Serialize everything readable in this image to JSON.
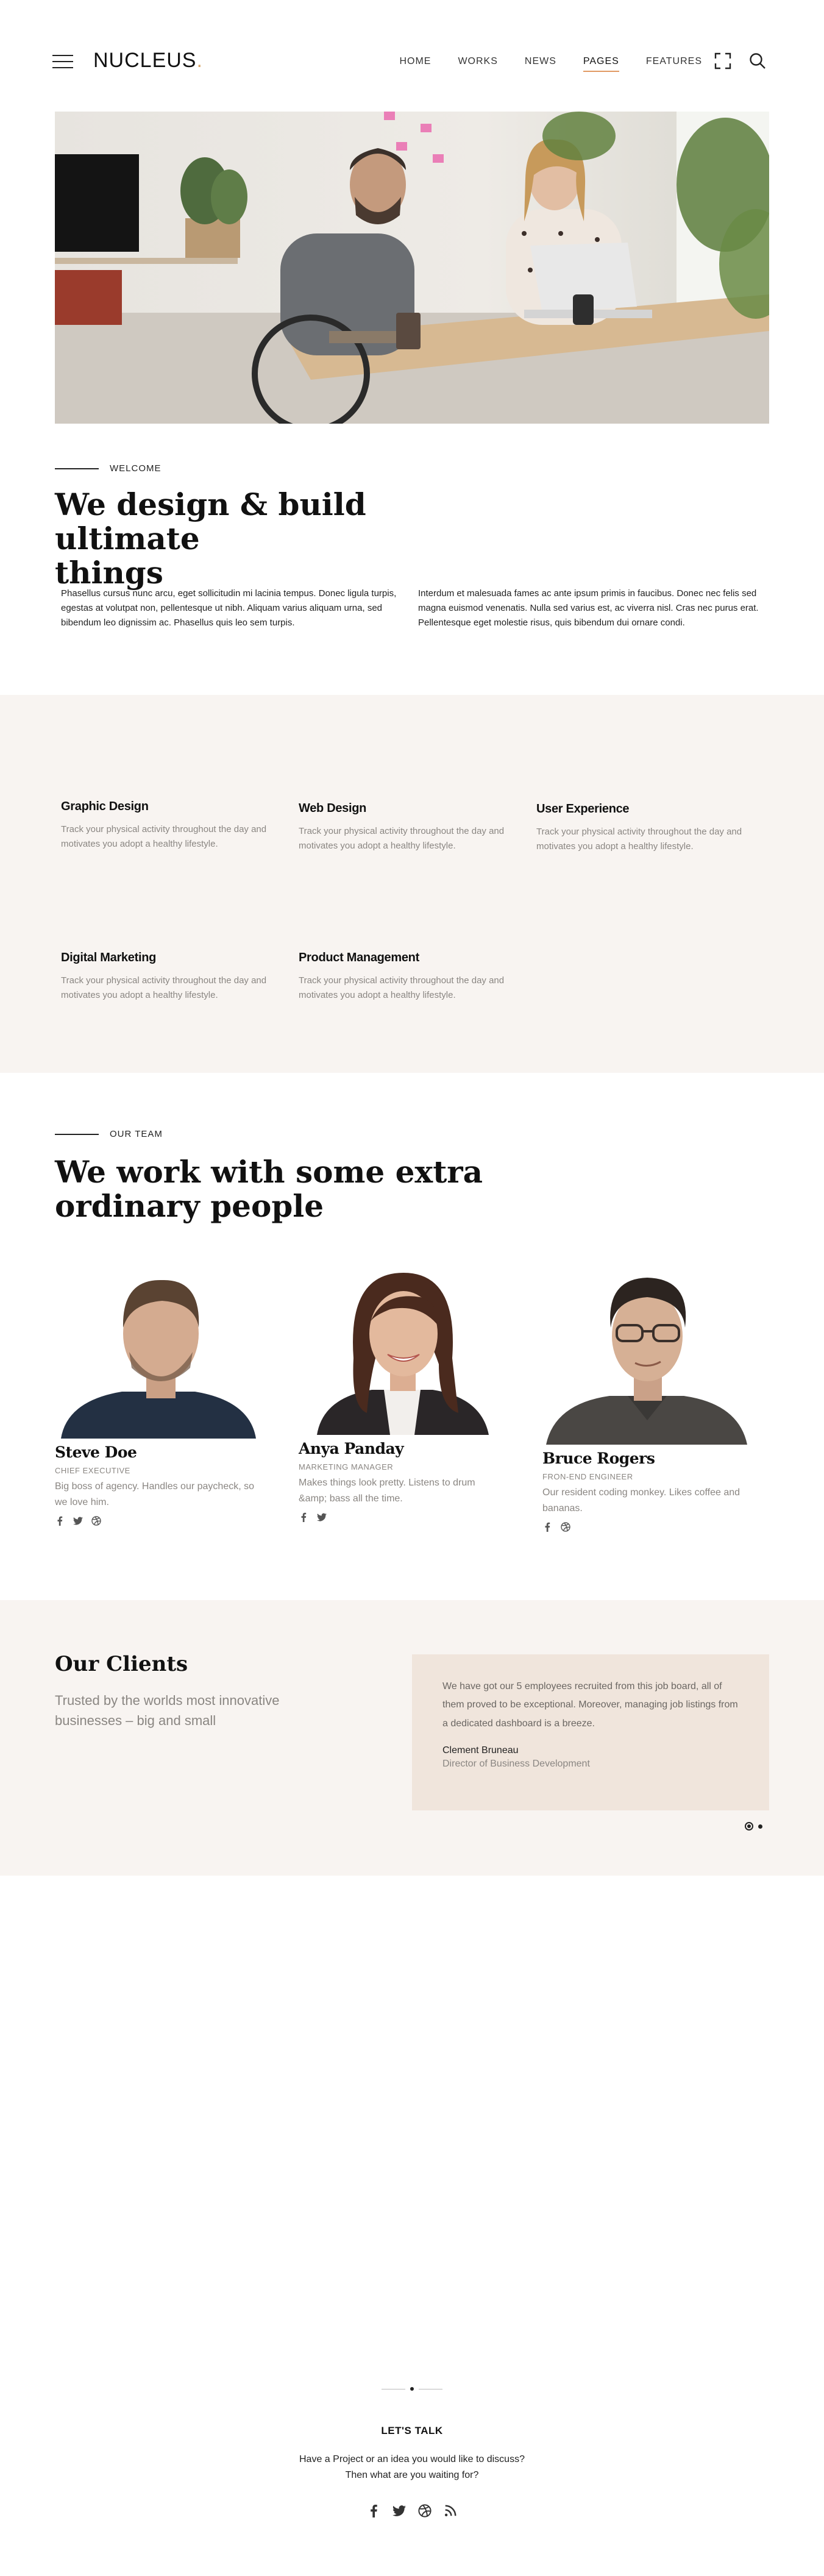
{
  "header": {
    "logo_text": "NUCLEUS",
    "logo_dot": ".",
    "nav": [
      {
        "label": "HOME"
      },
      {
        "label": "WORKS"
      },
      {
        "label": "NEWS"
      },
      {
        "label": "PAGES",
        "active": true
      },
      {
        "label": "FEATURES"
      }
    ],
    "icons": [
      "menu-icon",
      "expand-icon",
      "search-icon"
    ]
  },
  "welcome": {
    "eyebrow": "WELCOME",
    "title_line1": "We design & build ultimate",
    "title_line2": "things",
    "para_left": "Phasellus cursus nunc arcu, eget sollicitudin mi lacinia tempus. Donec ligula turpis, egestas at volutpat non, pellentesque ut nibh. Aliquam varius aliquam urna, sed bibendum leo dignissim ac. Phasellus quis leo sem turpis.",
    "para_right": "Interdum et malesuada fames ac ante ipsum primis in faucibus. Donec nec felis sed magna euismod venenatis. Nulla sed varius est, ac viverra nisl. Cras nec purus erat. Pellentesque eget molestie risus, quis bibendum dui ornare condi."
  },
  "services": [
    {
      "title": "Graphic Design",
      "desc": "Track your physical activity throughout the day and motivates you adopt a healthy lifestyle."
    },
    {
      "title": "Web Design",
      "desc": "Track your physical activity throughout the day and motivates you adopt a healthy lifestyle."
    },
    {
      "title": "User Experience",
      "desc": "Track your physical activity throughout the day and motivates you adopt a healthy lifestyle."
    },
    {
      "title": "Digital Marketing",
      "desc": "Track your physical activity throughout the day and motivates you adopt a healthy lifestyle."
    },
    {
      "title": "Product Management",
      "desc": "Track your physical activity throughout the day and motivates you adopt a healthy lifestyle."
    }
  ],
  "team": {
    "eyebrow": "OUR TEAM",
    "title_line1": "We work with some extra",
    "title_line2": "ordinary people",
    "members": [
      {
        "name": "Steve Doe",
        "role": "CHIEF EXECUTIVE",
        "bio": "Big boss of agency. Handles our paycheck, so we love him.",
        "socials": [
          "facebook-icon",
          "twitter-icon",
          "dribbble-icon"
        ]
      },
      {
        "name": "Anya Panday",
        "role": "MARKETING MANAGER",
        "bio": "Makes things look pretty. Listens to drum &amp; bass all the time.",
        "socials": [
          "facebook-icon",
          "twitter-icon"
        ]
      },
      {
        "name": "Bruce Rogers",
        "role": "FRON-END ENGINEER",
        "bio": "Our resident coding monkey. Likes coffee and bananas.",
        "socials": [
          "facebook-icon",
          "dribbble-icon"
        ]
      }
    ]
  },
  "clients": {
    "title": "Our Clients",
    "subtitle": "Trusted by the worlds most innovative businesses – big and small",
    "quote": "We have got our 5 employees recruited from this job board, all of them proved to be exceptional. Moreover, managing job listings from a dedicated dashboard is a breeze.",
    "author": "Clement Bruneau",
    "author_role": "Director of Business Development"
  },
  "footer": {
    "title": "LET'S TALK",
    "line1": "Have a Project or an idea you would like to discuss?",
    "line2": "Then what are you waiting for?",
    "socials": [
      "facebook-icon",
      "twitter-icon",
      "dribbble-icon",
      "rss-icon"
    ]
  },
  "colors": {
    "accent": "#d9a86c",
    "nav_underline": "#e19a63",
    "section_bg": "#f8f4f1",
    "quote_bg": "#f0e5dc",
    "muted_text": "#8a8682"
  }
}
